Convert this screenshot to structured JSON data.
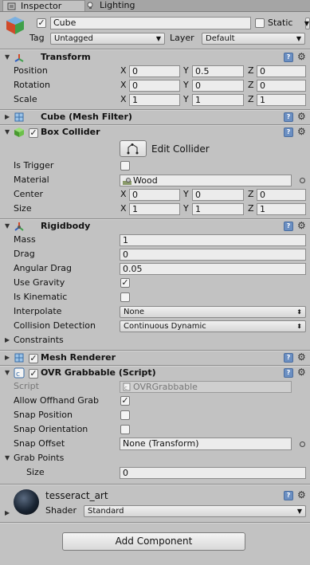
{
  "tabs": [
    {
      "label": "Inspector"
    },
    {
      "label": "Lighting"
    }
  ],
  "object": {
    "name": "Cube",
    "static_label": "Static",
    "tag_label": "Tag",
    "tag_value": "Untagged",
    "layer_label": "Layer",
    "layer_value": "Default"
  },
  "transform": {
    "title": "Transform",
    "position": {
      "label": "Position",
      "x": "0",
      "y": "0.5",
      "z": "0"
    },
    "rotation": {
      "label": "Rotation",
      "x": "0",
      "y": "0",
      "z": "0"
    },
    "scale": {
      "label": "Scale",
      "x": "1",
      "y": "1",
      "z": "1"
    }
  },
  "axis": {
    "x": "X",
    "y": "Y",
    "z": "Z"
  },
  "mesh_filter": {
    "title": "Cube (Mesh Filter)"
  },
  "box_collider": {
    "title": "Box Collider",
    "edit_label": "Edit Collider",
    "is_trigger_label": "Is Trigger",
    "material_label": "Material",
    "material_value": "Wood",
    "center": {
      "label": "Center",
      "x": "0",
      "y": "0",
      "z": "0"
    },
    "size": {
      "label": "Size",
      "x": "1",
      "y": "1",
      "z": "1"
    }
  },
  "rigidbody": {
    "title": "Rigidbody",
    "mass_label": "Mass",
    "mass": "1",
    "drag_label": "Drag",
    "drag": "0",
    "angular_drag_label": "Angular Drag",
    "angular_drag": "0.05",
    "use_gravity_label": "Use Gravity",
    "use_gravity": true,
    "is_kinematic_label": "Is Kinematic",
    "is_kinematic": false,
    "interpolate_label": "Interpolate",
    "interpolate": "None",
    "collision_label": "Collision Detection",
    "collision": "Continuous Dynamic",
    "constraints_label": "Constraints"
  },
  "mesh_renderer": {
    "title": "Mesh Renderer"
  },
  "ovr_grabbable": {
    "title": "OVR Grabbable (Script)",
    "script_label": "Script",
    "script_value": "OVRGrabbable",
    "allow_offhand_label": "Allow Offhand Grab",
    "allow_offhand": true,
    "snap_position_label": "Snap Position",
    "snap_orientation_label": "Snap Orientation",
    "snap_offset_label": "Snap Offset",
    "snap_offset": "None (Transform)",
    "grab_points_label": "Grab Points",
    "size_label": "Size",
    "size": "0"
  },
  "material": {
    "name": "tesseract_art",
    "shader_label": "Shader",
    "shader_value": "Standard"
  },
  "add_component_label": "Add Component",
  "colors": {
    "panel_bg": "#c2c2c2",
    "tab_bg": "#a5a5a5",
    "field_bg": "#ececec",
    "help_icon": "#6b8fc2"
  }
}
